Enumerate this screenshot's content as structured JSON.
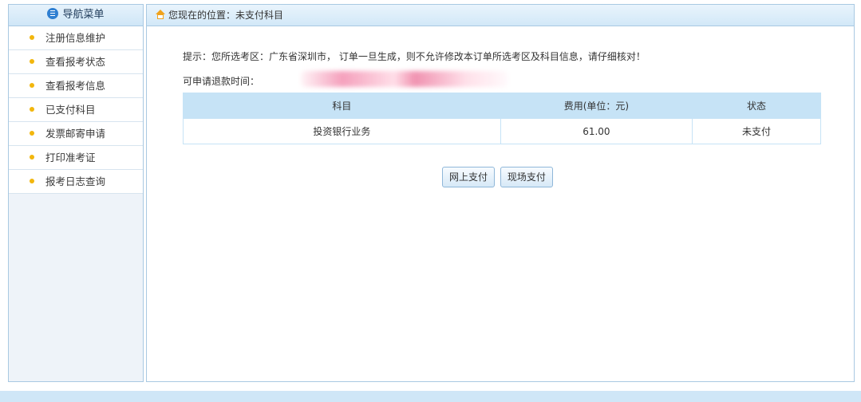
{
  "sidebar": {
    "title": "导航菜单",
    "items": [
      {
        "label": "注册信息维护"
      },
      {
        "label": "查看报考状态"
      },
      {
        "label": "查看报考信息"
      },
      {
        "label": "已支付科目"
      },
      {
        "label": "发票邮寄申请"
      },
      {
        "label": "打印准考证"
      },
      {
        "label": "报考日志查询"
      }
    ]
  },
  "breadcrumb": {
    "text": "您现在的位置：未支付科目"
  },
  "notice": "提示：您所选考区：广东省深圳市， 订单一旦生成，则不允许修改本订单所选考区及科目信息，请仔细核对！",
  "refund": {
    "label": "可申请退款时间："
  },
  "table": {
    "headers": [
      "科目",
      "费用(单位：元)",
      "状态"
    ],
    "rows": [
      [
        "投资银行业务",
        "61.00",
        "未支付"
      ]
    ]
  },
  "actions": {
    "online_pay": "网上支付",
    "onsite_pay": "现场支付"
  }
}
